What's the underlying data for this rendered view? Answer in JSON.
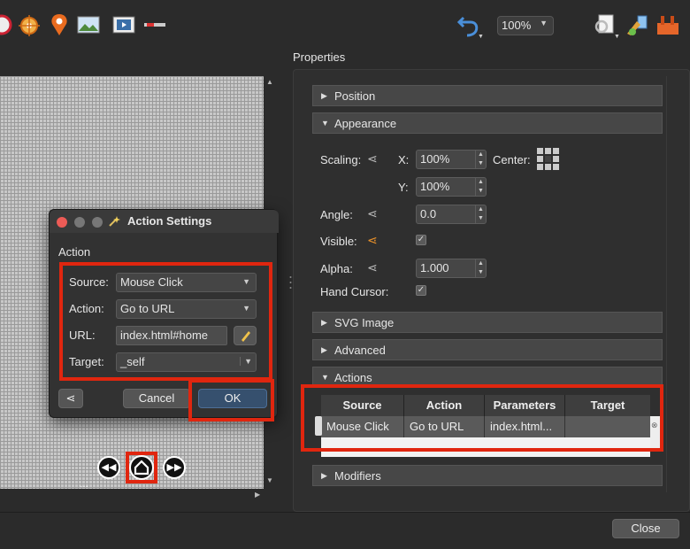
{
  "toolbar": {
    "zoom": "100%"
  },
  "canvas": {
    "partial_caption": "…"
  },
  "dialog": {
    "title": "Action Settings",
    "group_label": "Action",
    "source_label": "Source:",
    "source_value": "Mouse Click",
    "action_label": "Action:",
    "action_value": "Go to URL",
    "url_label": "URL:",
    "url_value": "index.html#home",
    "target_label": "Target:",
    "target_value": "_self",
    "cancel_label": "Cancel",
    "ok_label": "OK"
  },
  "properties": {
    "title": "Properties",
    "sections": {
      "position": "Position",
      "appearance": "Appearance",
      "svg_image": "SVG Image",
      "advanced": "Advanced",
      "actions": "Actions",
      "modifiers": "Modifiers"
    },
    "appearance": {
      "scaling_label": "Scaling:",
      "x_label": "X:",
      "x_value": "100%",
      "y_label": "Y:",
      "y_value": "100%",
      "center_label": "Center:",
      "angle_label": "Angle:",
      "angle_value": "0.0",
      "visible_label": "Visible:",
      "visible_checked": true,
      "alpha_label": "Alpha:",
      "alpha_value": "1.000",
      "hand_cursor_label": "Hand Cursor:",
      "hand_cursor_checked": true
    },
    "actions_table": {
      "headers": [
        "Source",
        "Action",
        "Parameters",
        "Target"
      ],
      "rows": [
        [
          "Mouse Click",
          "Go to URL",
          "index.html...",
          ""
        ]
      ]
    }
  },
  "footer": {
    "close_label": "Close"
  },
  "colors": {
    "highlight_red": "#e0260f",
    "background": "#2b2b2b"
  }
}
